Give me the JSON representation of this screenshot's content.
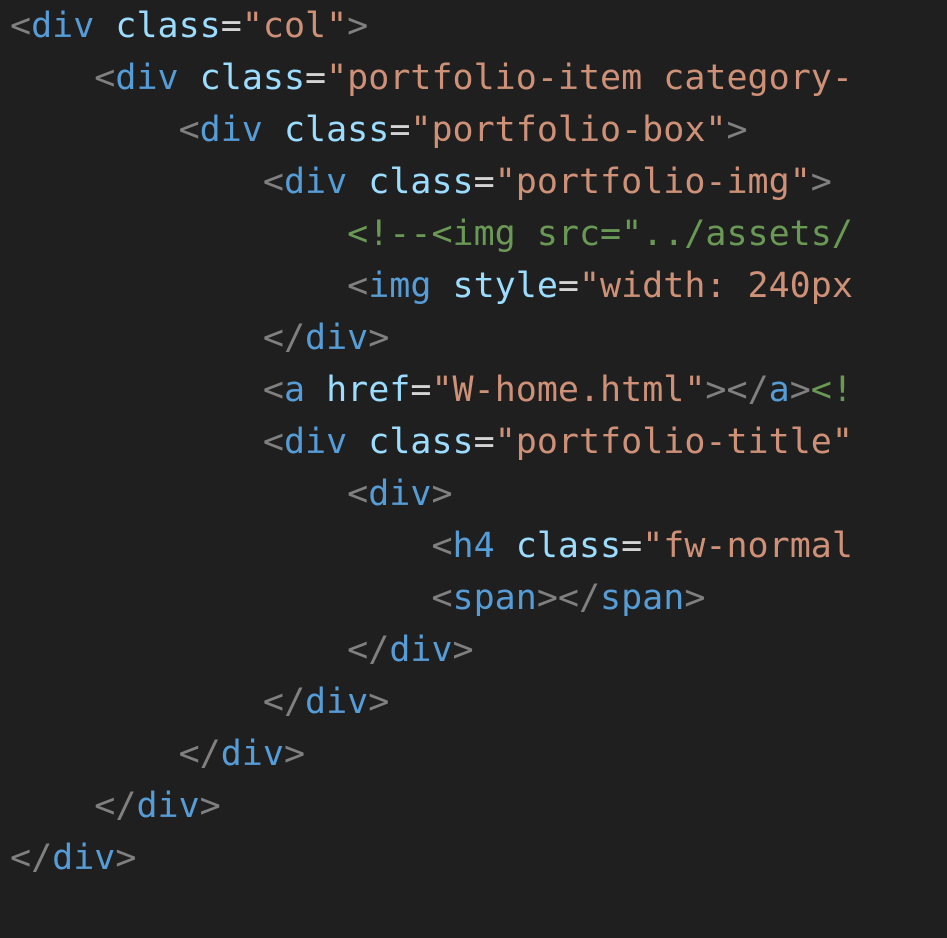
{
  "colors": {
    "background": "#1f1f1f",
    "punctuation": "#808080",
    "tag": "#569cd6",
    "attribute": "#9cdcfe",
    "string": "#ce9178",
    "comment": "#6a9955",
    "text": "#d4d4d4"
  },
  "lines": [
    {
      "indent": "",
      "tokens": [
        {
          "t": "punct",
          "v": "<"
        },
        {
          "t": "tag",
          "v": "div"
        },
        {
          "t": "text",
          "v": " "
        },
        {
          "t": "attr",
          "v": "class"
        },
        {
          "t": "eq",
          "v": "="
        },
        {
          "t": "str",
          "v": "\"col\""
        },
        {
          "t": "punct",
          "v": ">"
        }
      ]
    },
    {
      "indent": "    ",
      "tokens": [
        {
          "t": "punct",
          "v": "<"
        },
        {
          "t": "tag",
          "v": "div"
        },
        {
          "t": "text",
          "v": " "
        },
        {
          "t": "attr",
          "v": "class"
        },
        {
          "t": "eq",
          "v": "="
        },
        {
          "t": "str",
          "v": "\"portfolio-item category-"
        }
      ]
    },
    {
      "indent": "        ",
      "tokens": [
        {
          "t": "punct",
          "v": "<"
        },
        {
          "t": "tag",
          "v": "div"
        },
        {
          "t": "text",
          "v": " "
        },
        {
          "t": "attr",
          "v": "class"
        },
        {
          "t": "eq",
          "v": "="
        },
        {
          "t": "str",
          "v": "\"portfolio-box\""
        },
        {
          "t": "punct",
          "v": ">"
        }
      ]
    },
    {
      "indent": "            ",
      "tokens": [
        {
          "t": "punct",
          "v": "<"
        },
        {
          "t": "tag",
          "v": "div"
        },
        {
          "t": "text",
          "v": " "
        },
        {
          "t": "attr",
          "v": "class"
        },
        {
          "t": "eq",
          "v": "="
        },
        {
          "t": "str",
          "v": "\"portfolio-img\""
        },
        {
          "t": "punct",
          "v": ">"
        }
      ]
    },
    {
      "indent": "                ",
      "tokens": [
        {
          "t": "comment",
          "v": "<!--<img src=\"../assets/"
        }
      ]
    },
    {
      "indent": "                ",
      "tokens": [
        {
          "t": "punct",
          "v": "<"
        },
        {
          "t": "tag",
          "v": "img"
        },
        {
          "t": "text",
          "v": " "
        },
        {
          "t": "attr",
          "v": "style"
        },
        {
          "t": "eq",
          "v": "="
        },
        {
          "t": "str",
          "v": "\"width: 240px"
        }
      ]
    },
    {
      "indent": "            ",
      "tokens": [
        {
          "t": "punct",
          "v": "</"
        },
        {
          "t": "tag",
          "v": "div"
        },
        {
          "t": "punct",
          "v": ">"
        }
      ]
    },
    {
      "indent": "            ",
      "tokens": [
        {
          "t": "punct",
          "v": "<"
        },
        {
          "t": "tag",
          "v": "a"
        },
        {
          "t": "text",
          "v": " "
        },
        {
          "t": "attr",
          "v": "href"
        },
        {
          "t": "eq",
          "v": "="
        },
        {
          "t": "str",
          "v": "\"W-home.html\""
        },
        {
          "t": "punct",
          "v": "></"
        },
        {
          "t": "tag",
          "v": "a"
        },
        {
          "t": "punct",
          "v": ">"
        },
        {
          "t": "comment",
          "v": "<!"
        }
      ]
    },
    {
      "indent": "            ",
      "tokens": [
        {
          "t": "punct",
          "v": "<"
        },
        {
          "t": "tag",
          "v": "div"
        },
        {
          "t": "text",
          "v": " "
        },
        {
          "t": "attr",
          "v": "class"
        },
        {
          "t": "eq",
          "v": "="
        },
        {
          "t": "str",
          "v": "\"portfolio-title\""
        }
      ]
    },
    {
      "indent": "                ",
      "tokens": [
        {
          "t": "punct",
          "v": "<"
        },
        {
          "t": "tag",
          "v": "div"
        },
        {
          "t": "punct",
          "v": ">"
        }
      ]
    },
    {
      "indent": "                    ",
      "tokens": [
        {
          "t": "punct",
          "v": "<"
        },
        {
          "t": "tag",
          "v": "h4"
        },
        {
          "t": "text",
          "v": " "
        },
        {
          "t": "attr",
          "v": "class"
        },
        {
          "t": "eq",
          "v": "="
        },
        {
          "t": "str",
          "v": "\"fw-normal"
        }
      ]
    },
    {
      "indent": "                    ",
      "tokens": [
        {
          "t": "punct",
          "v": "<"
        },
        {
          "t": "tag",
          "v": "span"
        },
        {
          "t": "punct",
          "v": "></"
        },
        {
          "t": "tag",
          "v": "span"
        },
        {
          "t": "punct",
          "v": ">"
        }
      ]
    },
    {
      "indent": "                ",
      "tokens": [
        {
          "t": "punct",
          "v": "</"
        },
        {
          "t": "tag",
          "v": "div"
        },
        {
          "t": "punct",
          "v": ">"
        }
      ]
    },
    {
      "indent": "            ",
      "tokens": [
        {
          "t": "punct",
          "v": "</"
        },
        {
          "t": "tag",
          "v": "div"
        },
        {
          "t": "punct",
          "v": ">"
        }
      ]
    },
    {
      "indent": "        ",
      "tokens": [
        {
          "t": "punct",
          "v": "</"
        },
        {
          "t": "tag",
          "v": "div"
        },
        {
          "t": "punct",
          "v": ">"
        }
      ]
    },
    {
      "indent": "    ",
      "tokens": [
        {
          "t": "punct",
          "v": "</"
        },
        {
          "t": "tag",
          "v": "div"
        },
        {
          "t": "punct",
          "v": ">"
        }
      ]
    },
    {
      "indent": "",
      "tokens": [
        {
          "t": "punct",
          "v": "</"
        },
        {
          "t": "tag",
          "v": "div"
        },
        {
          "t": "punct",
          "v": ">"
        }
      ]
    }
  ]
}
